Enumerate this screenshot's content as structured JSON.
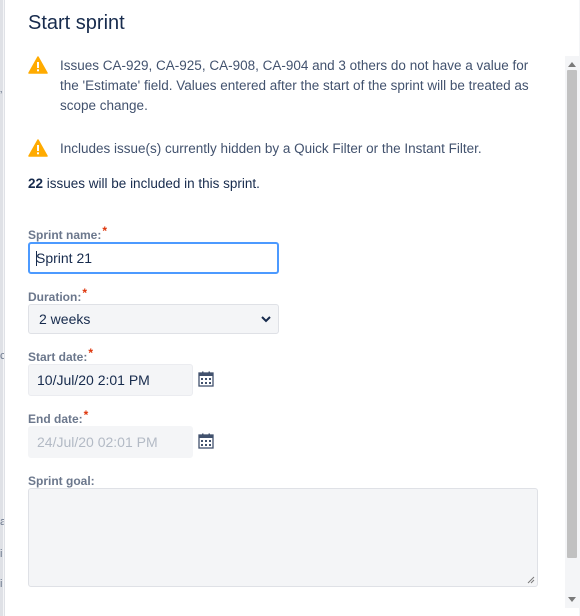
{
  "dialog": {
    "title": "Start sprint",
    "warning_estimate": "Issues CA-929, CA-925, CA-908, CA-904 and 3 others do not have a value for the 'Estimate' field. Values entered after the start of the sprint will be treated as scope change.",
    "warning_filter": "Includes issue(s) currently hidden by a Quick Filter or the Instant Filter.",
    "issue_count": "22",
    "issue_count_text": " issues will be included in this sprint.",
    "required_mark": "*"
  },
  "form": {
    "sprint_name_label": "Sprint name:",
    "sprint_name_value": "Sprint 21",
    "duration_label": "Duration:",
    "duration_value": "2 weeks",
    "start_date_label": "Start date:",
    "start_date_value": "10/Jul/20 2:01 PM",
    "end_date_label": "End date:",
    "end_date_value": "24/Jul/20 02:01 PM",
    "sprint_goal_label": "Sprint goal:",
    "sprint_goal_value": ""
  },
  "background": {
    "edge_letters": [
      "c",
      "a",
      "i",
      "i"
    ]
  },
  "colors": {
    "warning": "#ffab00",
    "focus_border": "#4c9aff",
    "required": "#de350b"
  },
  "icons": {
    "warning": "warning-icon",
    "calendar": "calendar-icon",
    "chevron": "chevron-down-icon",
    "resize": "resize-grip-icon"
  }
}
